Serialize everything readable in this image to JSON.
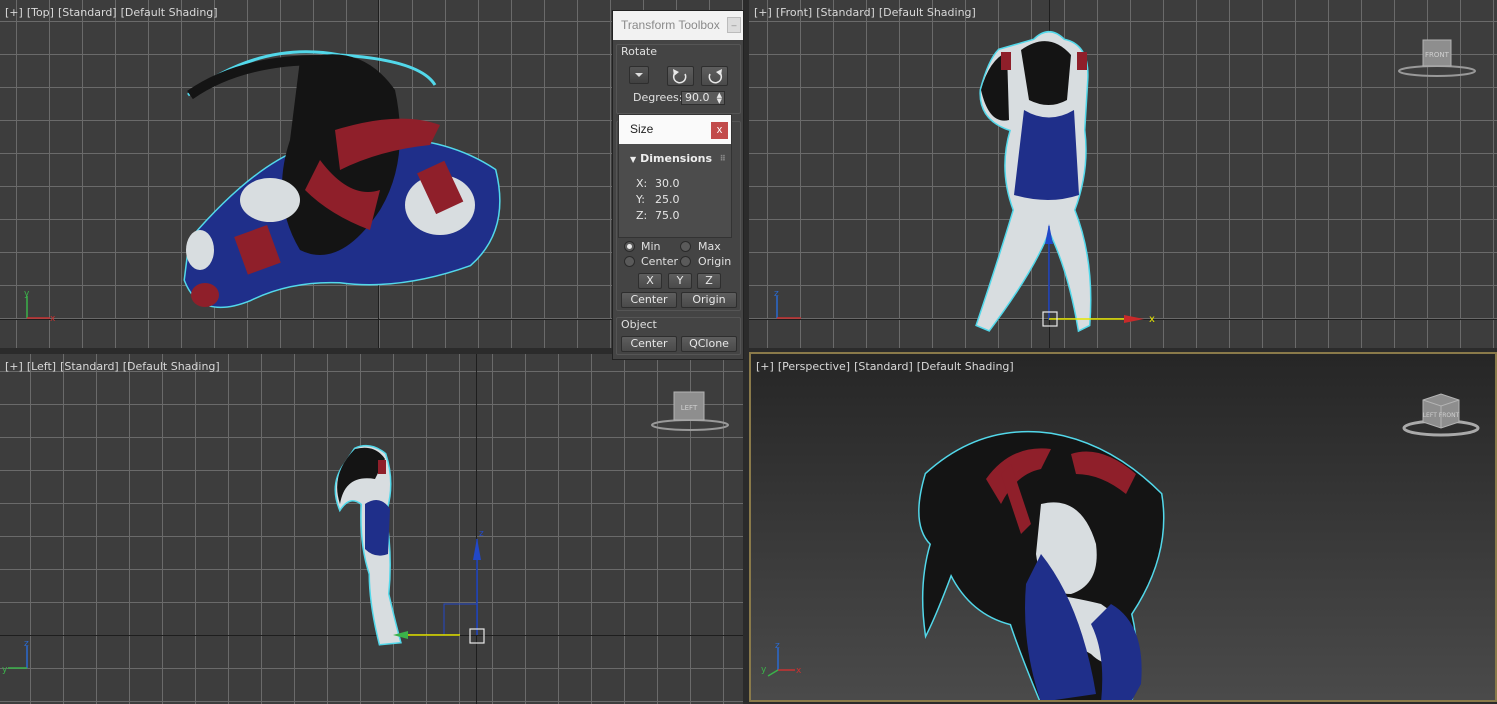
{
  "viewports": {
    "top": {
      "labels": [
        "[+]",
        "[Top]",
        "[Standard]",
        "[Default Shading]"
      ],
      "view_cube": ""
    },
    "front": {
      "labels": [
        "[+]",
        "[Front]",
        "[Standard]",
        "[Default Shading]"
      ],
      "view_cube": "FRONT"
    },
    "left": {
      "labels": [
        "[+]",
        "[Left]",
        "[Standard]",
        "[Default Shading]"
      ],
      "view_cube": "LEFT"
    },
    "perspective": {
      "labels": [
        "[+]",
        "[Perspective]",
        "[Standard]",
        "[Default Shading]"
      ],
      "view_cube": "LEFT FRONT"
    }
  },
  "axis_labels": {
    "x": "x",
    "y": "y",
    "z": "z"
  },
  "toolbox": {
    "title": "Transform Toolbox",
    "rotate": {
      "label": "Rotate",
      "degrees_label": "Degrees:",
      "degrees_value": "90.0"
    },
    "align": {
      "min_label": "Min",
      "max_label": "Max",
      "center_label": "Center",
      "origin_label": "Origin",
      "selected": "Min",
      "x_button": "X",
      "y_button": "Y",
      "z_button": "Z",
      "center_button": "Center",
      "origin_button": "Origin"
    },
    "object": {
      "label": "Object",
      "center_button": "Center",
      "qclone_button": "QClone"
    }
  },
  "size_popup": {
    "title": "Size",
    "close_label": "x",
    "rollout_label": "Dimensions",
    "dimensions": [
      {
        "axis": "X:",
        "value": "30.0"
      },
      {
        "axis": "Y:",
        "value": "25.0"
      },
      {
        "axis": "Z:",
        "value": "75.0"
      }
    ]
  },
  "colors": {
    "selection_outline": "#52d8ea",
    "outfit_blue": "#1f2f8a",
    "accent_red": "#8f1f2a",
    "hair": "#141414",
    "skin": "#d8dde0",
    "grid": "#6a6a6a",
    "viewport_bg": "#3d3d3d"
  }
}
